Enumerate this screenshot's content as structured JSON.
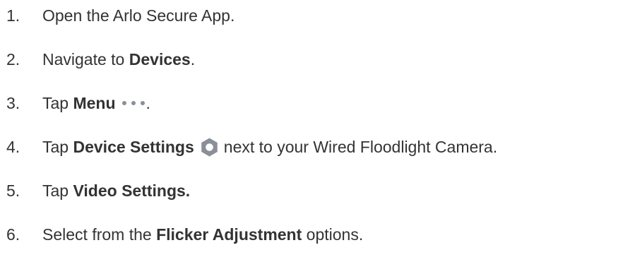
{
  "steps": [
    {
      "number": "1.",
      "text": "Open the Arlo Secure App."
    },
    {
      "number": "2.",
      "pre": "Navigate to ",
      "bold": "Devices",
      "post": "."
    },
    {
      "number": "3.",
      "pre": "Tap ",
      "bold": "Menu",
      "post": ".",
      "icon": "more-dots-icon"
    },
    {
      "number": "4.",
      "pre": "Tap ",
      "bold": "Device Settings",
      "post": "next to your Wired Floodlight Camera.",
      "icon": "gear-icon"
    },
    {
      "number": "5.",
      "pre": "Tap ",
      "bold": "Video Settings."
    },
    {
      "number": "6.",
      "pre": "Select from the ",
      "bold": "Flicker Adjustment",
      "post": " options."
    }
  ],
  "colors": {
    "text": "#333333",
    "icon": "#8a8f98"
  }
}
